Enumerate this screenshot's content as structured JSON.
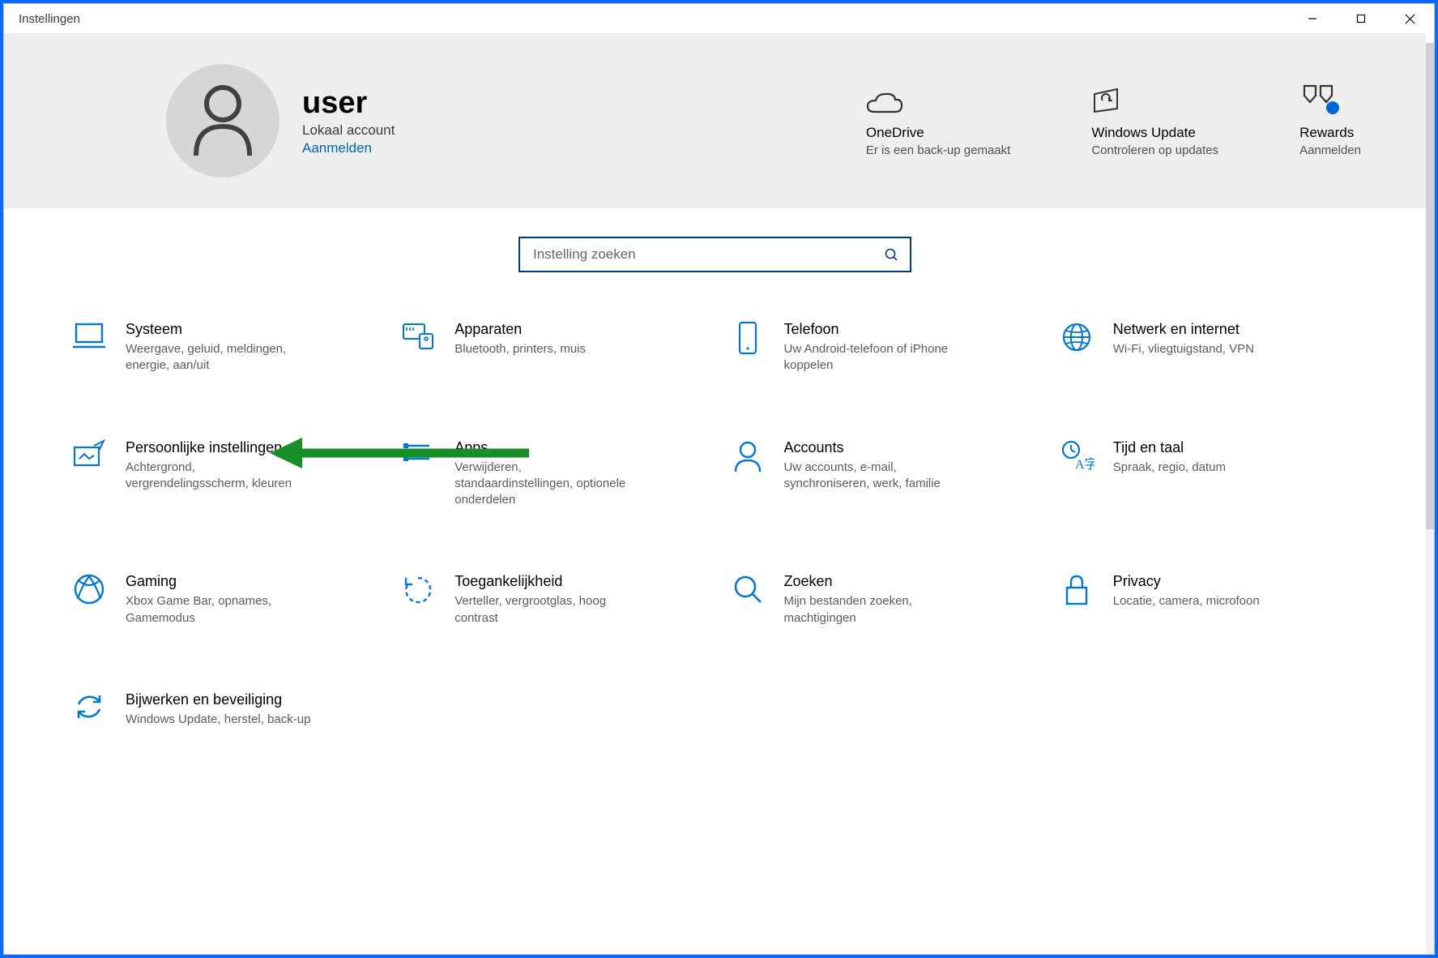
{
  "window_title": "Instellingen",
  "banner": {
    "user_name": "user",
    "user_sub": "Lokaal account",
    "sign_in": "Aanmelden",
    "status": [
      {
        "title": "OneDrive",
        "sub": "Er is een back-up gemaakt"
      },
      {
        "title": "Windows Update",
        "sub": "Controleren op updates"
      },
      {
        "title": "Rewards",
        "sub": "Aanmelden"
      }
    ]
  },
  "search": {
    "placeholder": "Instelling zoeken"
  },
  "tiles": [
    {
      "title": "Systeem",
      "desc": "Weergave, geluid, meldingen, energie, aan/uit"
    },
    {
      "title": "Apparaten",
      "desc": "Bluetooth, printers, muis"
    },
    {
      "title": "Telefoon",
      "desc": "Uw Android-telefoon of iPhone koppelen"
    },
    {
      "title": "Netwerk en internet",
      "desc": "Wi-Fi, vliegtuigstand, VPN"
    },
    {
      "title": "Persoonlijke instellingen",
      "desc": "Achtergrond, vergrendelingsscherm, kleuren"
    },
    {
      "title": "Apps",
      "desc": "Verwijderen, standaardinstellingen, optionele onderdelen"
    },
    {
      "title": "Accounts",
      "desc": "Uw accounts, e-mail, synchroniseren, werk, familie"
    },
    {
      "title": "Tijd en taal",
      "desc": "Spraak, regio, datum"
    },
    {
      "title": "Gaming",
      "desc": "Xbox Game Bar, opnames, Gamemodus"
    },
    {
      "title": "Toegankelijkheid",
      "desc": "Verteller, vergrootglas, hoog contrast"
    },
    {
      "title": "Zoeken",
      "desc": "Mijn bestanden zoeken, machtigingen"
    },
    {
      "title": "Privacy",
      "desc": "Locatie, camera, microfoon"
    },
    {
      "title": "Bijwerken en beveiliging",
      "desc": "Windows Update, herstel, back-up"
    }
  ]
}
